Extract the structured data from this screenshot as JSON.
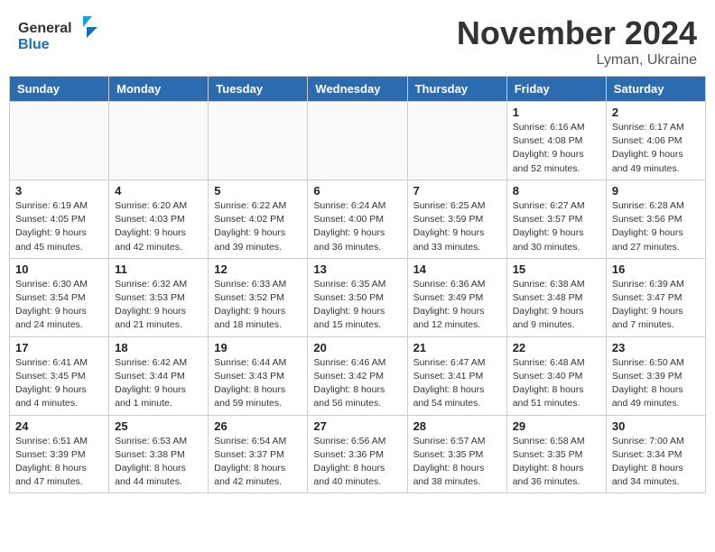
{
  "header": {
    "logo_line1": "General",
    "logo_line2": "Blue",
    "month": "November 2024",
    "location": "Lyman, Ukraine"
  },
  "days_of_week": [
    "Sunday",
    "Monday",
    "Tuesday",
    "Wednesday",
    "Thursday",
    "Friday",
    "Saturday"
  ],
  "weeks": [
    [
      {
        "day": "",
        "info": ""
      },
      {
        "day": "",
        "info": ""
      },
      {
        "day": "",
        "info": ""
      },
      {
        "day": "",
        "info": ""
      },
      {
        "day": "",
        "info": ""
      },
      {
        "day": "1",
        "info": "Sunrise: 6:16 AM\nSunset: 4:08 PM\nDaylight: 9 hours\nand 52 minutes."
      },
      {
        "day": "2",
        "info": "Sunrise: 6:17 AM\nSunset: 4:06 PM\nDaylight: 9 hours\nand 49 minutes."
      }
    ],
    [
      {
        "day": "3",
        "info": "Sunrise: 6:19 AM\nSunset: 4:05 PM\nDaylight: 9 hours\nand 45 minutes."
      },
      {
        "day": "4",
        "info": "Sunrise: 6:20 AM\nSunset: 4:03 PM\nDaylight: 9 hours\nand 42 minutes."
      },
      {
        "day": "5",
        "info": "Sunrise: 6:22 AM\nSunset: 4:02 PM\nDaylight: 9 hours\nand 39 minutes."
      },
      {
        "day": "6",
        "info": "Sunrise: 6:24 AM\nSunset: 4:00 PM\nDaylight: 9 hours\nand 36 minutes."
      },
      {
        "day": "7",
        "info": "Sunrise: 6:25 AM\nSunset: 3:59 PM\nDaylight: 9 hours\nand 33 minutes."
      },
      {
        "day": "8",
        "info": "Sunrise: 6:27 AM\nSunset: 3:57 PM\nDaylight: 9 hours\nand 30 minutes."
      },
      {
        "day": "9",
        "info": "Sunrise: 6:28 AM\nSunset: 3:56 PM\nDaylight: 9 hours\nand 27 minutes."
      }
    ],
    [
      {
        "day": "10",
        "info": "Sunrise: 6:30 AM\nSunset: 3:54 PM\nDaylight: 9 hours\nand 24 minutes."
      },
      {
        "day": "11",
        "info": "Sunrise: 6:32 AM\nSunset: 3:53 PM\nDaylight: 9 hours\nand 21 minutes."
      },
      {
        "day": "12",
        "info": "Sunrise: 6:33 AM\nSunset: 3:52 PM\nDaylight: 9 hours\nand 18 minutes."
      },
      {
        "day": "13",
        "info": "Sunrise: 6:35 AM\nSunset: 3:50 PM\nDaylight: 9 hours\nand 15 minutes."
      },
      {
        "day": "14",
        "info": "Sunrise: 6:36 AM\nSunset: 3:49 PM\nDaylight: 9 hours\nand 12 minutes."
      },
      {
        "day": "15",
        "info": "Sunrise: 6:38 AM\nSunset: 3:48 PM\nDaylight: 9 hours\nand 9 minutes."
      },
      {
        "day": "16",
        "info": "Sunrise: 6:39 AM\nSunset: 3:47 PM\nDaylight: 9 hours\nand 7 minutes."
      }
    ],
    [
      {
        "day": "17",
        "info": "Sunrise: 6:41 AM\nSunset: 3:45 PM\nDaylight: 9 hours\nand 4 minutes."
      },
      {
        "day": "18",
        "info": "Sunrise: 6:42 AM\nSunset: 3:44 PM\nDaylight: 9 hours\nand 1 minute."
      },
      {
        "day": "19",
        "info": "Sunrise: 6:44 AM\nSunset: 3:43 PM\nDaylight: 8 hours\nand 59 minutes."
      },
      {
        "day": "20",
        "info": "Sunrise: 6:46 AM\nSunset: 3:42 PM\nDaylight: 8 hours\nand 56 minutes."
      },
      {
        "day": "21",
        "info": "Sunrise: 6:47 AM\nSunset: 3:41 PM\nDaylight: 8 hours\nand 54 minutes."
      },
      {
        "day": "22",
        "info": "Sunrise: 6:48 AM\nSunset: 3:40 PM\nDaylight: 8 hours\nand 51 minutes."
      },
      {
        "day": "23",
        "info": "Sunrise: 6:50 AM\nSunset: 3:39 PM\nDaylight: 8 hours\nand 49 minutes."
      }
    ],
    [
      {
        "day": "24",
        "info": "Sunrise: 6:51 AM\nSunset: 3:39 PM\nDaylight: 8 hours\nand 47 minutes."
      },
      {
        "day": "25",
        "info": "Sunrise: 6:53 AM\nSunset: 3:38 PM\nDaylight: 8 hours\nand 44 minutes."
      },
      {
        "day": "26",
        "info": "Sunrise: 6:54 AM\nSunset: 3:37 PM\nDaylight: 8 hours\nand 42 minutes."
      },
      {
        "day": "27",
        "info": "Sunrise: 6:56 AM\nSunset: 3:36 PM\nDaylight: 8 hours\nand 40 minutes."
      },
      {
        "day": "28",
        "info": "Sunrise: 6:57 AM\nSunset: 3:35 PM\nDaylight: 8 hours\nand 38 minutes."
      },
      {
        "day": "29",
        "info": "Sunrise: 6:58 AM\nSunset: 3:35 PM\nDaylight: 8 hours\nand 36 minutes."
      },
      {
        "day": "30",
        "info": "Sunrise: 7:00 AM\nSunset: 3:34 PM\nDaylight: 8 hours\nand 34 minutes."
      }
    ]
  ]
}
